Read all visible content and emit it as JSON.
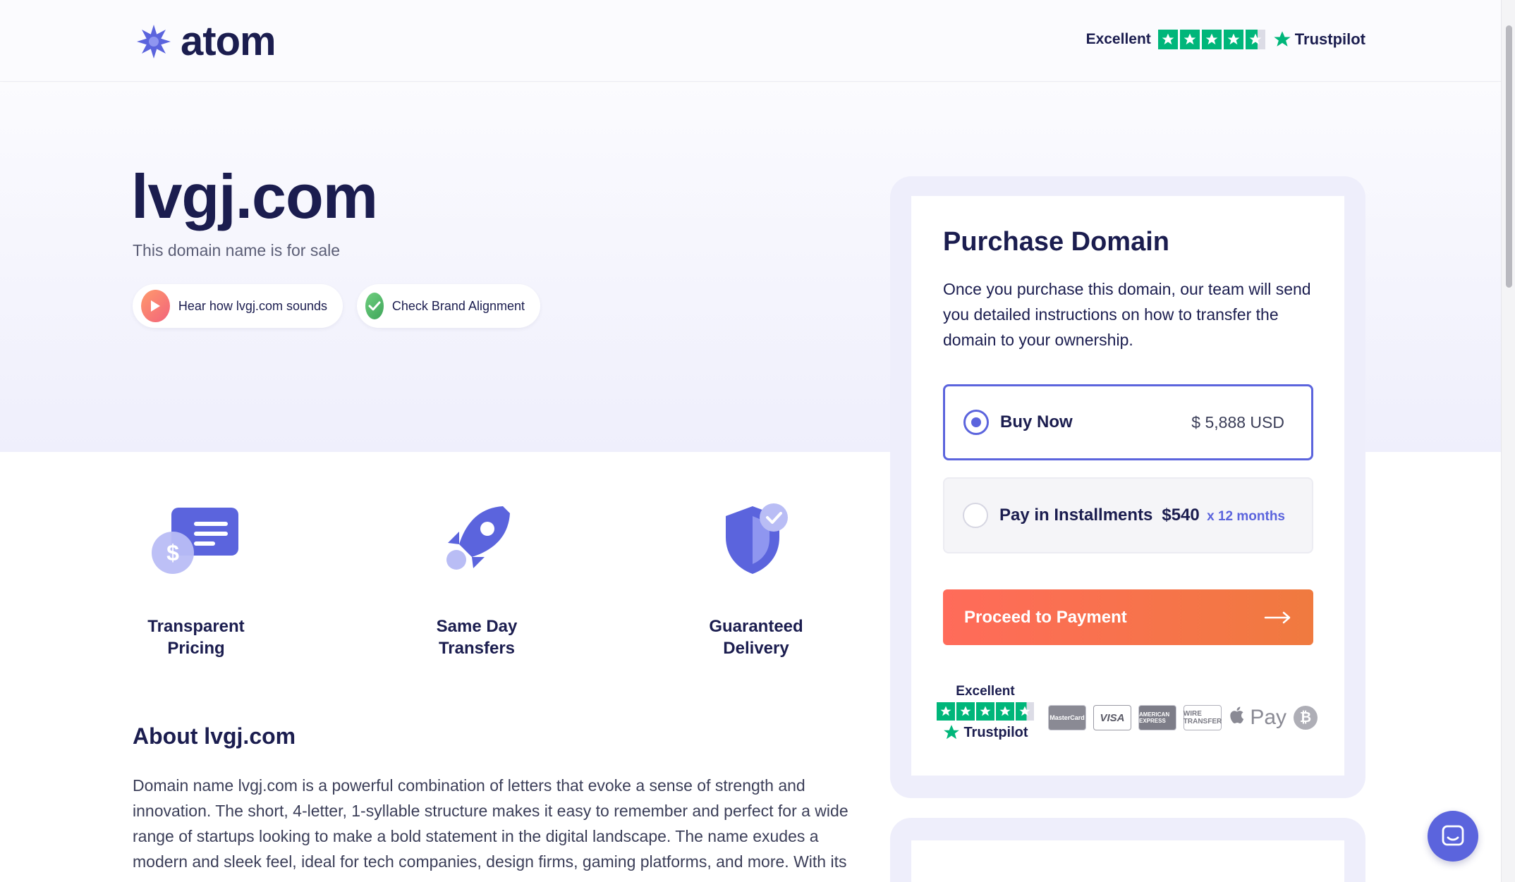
{
  "header": {
    "logo_text": "atom",
    "trustpilot": {
      "label": "Excellent",
      "brand": "Trustpilot",
      "rating": 4.5
    }
  },
  "hero": {
    "domain": "lvgj.com",
    "subtitle": "This domain name is for sale",
    "buttons": {
      "hear": "Hear how lvgj.com sounds",
      "brand": "Check Brand Alignment"
    }
  },
  "features": [
    {
      "line1": "Transparent",
      "line2": "Pricing"
    },
    {
      "line1": "Same Day",
      "line2": "Transfers"
    },
    {
      "line1": "Guaranteed",
      "line2": "Delivery"
    }
  ],
  "about": {
    "title": "About lvgj.com",
    "text": "Domain name lvgj.com is a powerful combination of letters that evoke a sense of strength and innovation. The short, 4-letter, 1-syllable structure makes it easy to remember and perfect for a wide range of startups looking to make a bold statement in the digital landscape. The name exudes a modern and sleek feel, ideal for tech companies, design firms, gaming platforms, and more. With its"
  },
  "purchase": {
    "title": "Purchase Domain",
    "description": "Once you purchase this domain, our team will send you detailed instructions on how to transfer the domain to your ownership.",
    "options": {
      "buy_now": {
        "label": "Buy Now",
        "price": "$ 5,888 USD",
        "selected": true
      },
      "installments": {
        "label": "Pay in Installments",
        "amount": "$540",
        "months": "x 12 months",
        "selected": false
      }
    },
    "proceed_label": "Proceed to Payment",
    "trustpilot": {
      "label": "Excellent",
      "brand": "Trustpilot"
    },
    "payment_methods": {
      "mastercard": "MasterCard",
      "visa": "VISA",
      "amex": "AMERICAN EXPRESS",
      "wire": "WIRE TRANSFER",
      "applepay": "Pay",
      "bitcoin": "₿"
    }
  },
  "colors": {
    "accent": "#5b64dd",
    "cta_start": "#ff6b5a",
    "cta_end": "#f07a3f",
    "trustpilot_green": "#00b67a",
    "text_dark": "#1b1d4f"
  }
}
